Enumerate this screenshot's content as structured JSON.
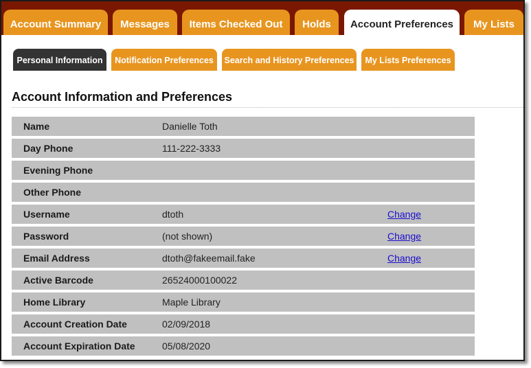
{
  "main_tabs": [
    {
      "label": "Account Summary",
      "active": false
    },
    {
      "label": "Messages",
      "active": false
    },
    {
      "label": "Items Checked Out",
      "active": false
    },
    {
      "label": "Holds",
      "active": false
    },
    {
      "label": "Account Preferences",
      "active": true
    },
    {
      "label": "My Lists",
      "active": false
    }
  ],
  "sub_tabs": [
    {
      "label": "Personal Information",
      "active": true
    },
    {
      "label": "Notification Preferences",
      "active": false
    },
    {
      "label": "Search and History Preferences",
      "active": false
    },
    {
      "label": "My Lists Preferences",
      "active": false
    }
  ],
  "heading": "Account Information and Preferences",
  "rows": [
    {
      "label": "Name",
      "value": "Danielle Toth",
      "action": ""
    },
    {
      "label": "Day Phone",
      "value": "111-222-3333",
      "action": ""
    },
    {
      "label": "Evening Phone",
      "value": "",
      "action": ""
    },
    {
      "label": "Other Phone",
      "value": "",
      "action": ""
    },
    {
      "label": "Username",
      "value": "dtoth",
      "action": "Change"
    },
    {
      "label": "Password",
      "value": "(not shown)",
      "action": "Change"
    },
    {
      "label": "Email Address",
      "value": "dtoth@fakeemail.fake",
      "action": "Change"
    },
    {
      "label": "Active Barcode",
      "value": "26524000100022",
      "action": ""
    },
    {
      "label": "Home Library",
      "value": "Maple Library",
      "action": ""
    },
    {
      "label": "Account Creation Date",
      "value": "02/09/2018",
      "action": ""
    },
    {
      "label": "Account Expiration Date",
      "value": "05/08/2020",
      "action": ""
    }
  ],
  "colors": {
    "tab_bar": "#7a1700",
    "tab": "#e8951f",
    "active_subtab": "#333333",
    "row_bg": "#c0c0c0",
    "link": "#1a0dcc"
  }
}
